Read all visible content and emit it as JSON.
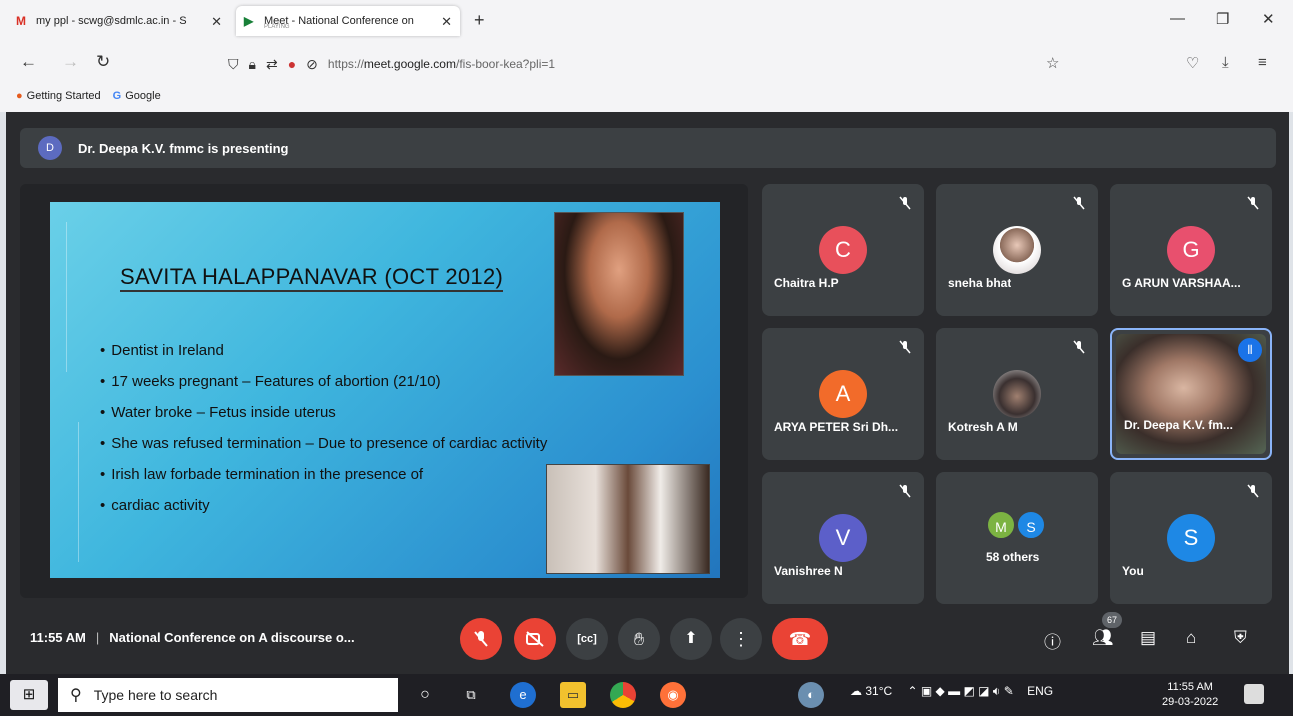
{
  "browser": {
    "tabs": [
      {
        "label": "my ppl - scwg@sdmlc.ac.in - S",
        "icon": "gmail-icon"
      },
      {
        "label": "Meet - National Conference on",
        "sub": "PLAYING",
        "icon": "meet-icon"
      }
    ],
    "new_tab": "+",
    "window": {
      "minimize": "—",
      "restore": "❐",
      "close": "✕"
    },
    "url_prefix": "https://",
    "url_host": "meet.google.com",
    "url_path": "/fis-boor-kea?pli=1",
    "bookmarks": [
      "Getting Started",
      "Google"
    ]
  },
  "meet": {
    "presenter_initial": "D",
    "presenting_text": "Dr. Deepa K.V. fmmc is presenting",
    "slide": {
      "title": "SAVITA HALAPPANAVAR (OCT 2012)",
      "bullets": [
        "Dentist in Ireland",
        "17 weeks pregnant – Features of abortion (21/10)",
        "Water broke – Fetus inside uterus",
        "She was refused termination – Due to presence of cardiac activity",
        "Irish law forbade termination in the presence of",
        "cardiac activity"
      ]
    },
    "participants": [
      {
        "initial": "C",
        "name": "Chaitra H.P",
        "color": "#e8505b",
        "muted": true
      },
      {
        "initial": "",
        "name": "sneha bhat",
        "color": "#8a7a70",
        "muted": true
      },
      {
        "initial": "G",
        "name": "G ARUN VARSHAA...",
        "color": "#e8506e",
        "muted": true
      },
      {
        "initial": "A",
        "name": "ARYA PETER Sri Dh...",
        "color": "#f26b2a",
        "muted": true
      },
      {
        "initial": "",
        "name": "Kotresh A M",
        "color": "#6a6a6a",
        "muted": true
      },
      {
        "initial": "",
        "name": "Dr. Deepa K.V. fm...",
        "color": "#1a73e8",
        "muted": false,
        "speaking": true
      },
      {
        "initial": "V",
        "name": "Vanishree N",
        "color": "#5c5fc9",
        "muted": true
      },
      {
        "initial": "",
        "name": "58 others",
        "color": "#3c4043",
        "muted": false
      },
      {
        "initial": "S",
        "name": "You",
        "color": "#1e88e5",
        "muted": true
      }
    ],
    "others_avatars": [
      "M",
      "S"
    ],
    "time": "11:55 AM",
    "meeting_name": "National Conference on A discourse o...",
    "people_count": "67"
  },
  "taskbar": {
    "search_placeholder": "Type here to search",
    "weather": "31°C",
    "lang": "ENG",
    "time": "11:55 AM",
    "date": "29-03-2022"
  }
}
